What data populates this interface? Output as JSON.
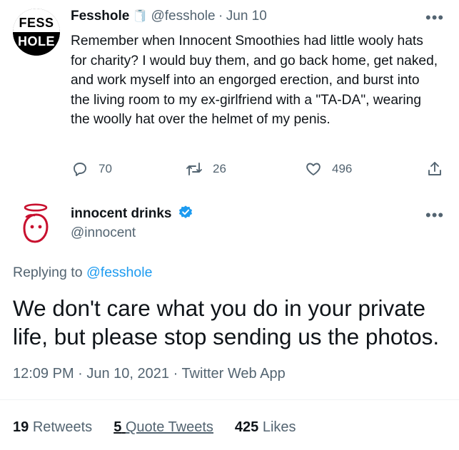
{
  "tweet": {
    "avatar_logo": {
      "top": "FESS",
      "bottom": "HOLE"
    },
    "author_name": "Fesshole",
    "author_emoji": "🧻",
    "handle": "@fesshole",
    "separator": "·",
    "date": "Jun 10",
    "text": "Remember when Innocent Smoothies had little wooly hats for charity? I would buy them, and go back home, get naked, and work myself into an engorged erection, and burst into the living room to my ex-girlfriend with a \"TA-DA\", wearing the woolly hat over the helmet of my penis.",
    "more_label": "•••",
    "actions": {
      "reply_count": "70",
      "retweet_count": "26",
      "like_count": "496"
    },
    "icons": [
      "reply-icon",
      "retweet-icon",
      "like-icon",
      "share-icon"
    ]
  },
  "reply": {
    "author_name": "innocent drinks",
    "handle": "@innocent",
    "more_label": "•••",
    "replying_to_label": "Replying to",
    "replying_to_handle": "@fesshole",
    "text": "We don't care what you do in your private life, but please stop sending us the photos.",
    "meta": "12:09 PM · Jun 10, 2021 · Twitter Web App",
    "stats": {
      "retweets_count": "19",
      "retweets_label": "Retweets",
      "quotes_count": "5",
      "quotes_label": "Quote Tweets",
      "likes_count": "425",
      "likes_label": "Likes"
    }
  },
  "colors": {
    "accent": "#1d9bf0",
    "text": "#0f1419",
    "muted": "#536471",
    "innocent_red": "#c8102e"
  }
}
